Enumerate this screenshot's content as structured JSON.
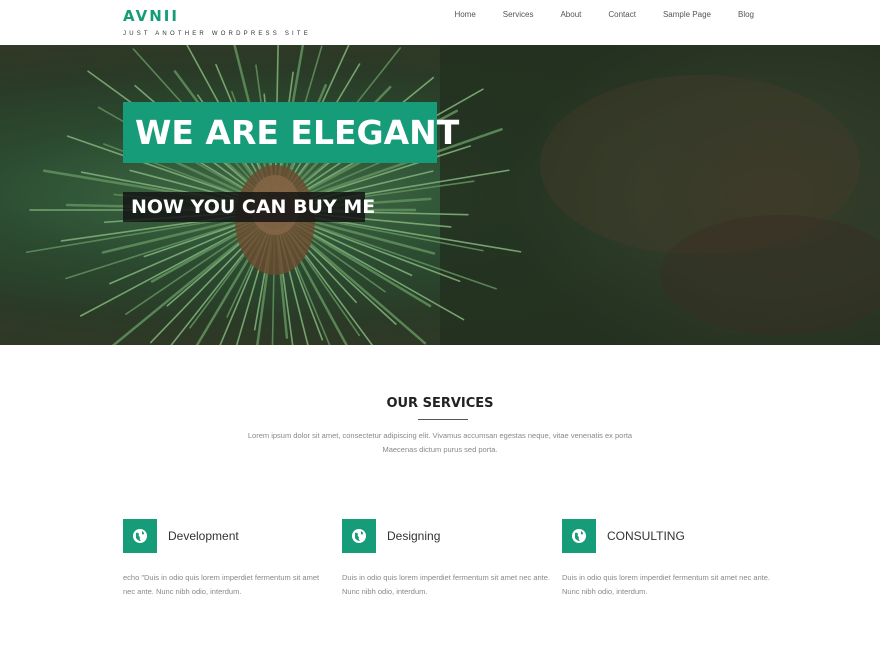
{
  "site": {
    "title": "AVNII",
    "tagline": "JUST ANOTHER WORDPRESS SITE",
    "accent": "#169c78"
  },
  "nav": {
    "items": [
      {
        "label": "Home"
      },
      {
        "label": "Services"
      },
      {
        "label": "About"
      },
      {
        "label": "Contact"
      },
      {
        "label": "Sample Page"
      },
      {
        "label": "Blog"
      }
    ]
  },
  "hero": {
    "title": "WE ARE ELEGANT",
    "subtitle": "NOW YOU CAN BUY ME"
  },
  "services": {
    "heading": "OUR SERVICES",
    "intro_line1": "Lorem ipsum dolor sit amet, consectetur adipiscing elit. Vivamus accumsan egestas neque, vitae venenatis ex porta",
    "intro_line2": "Maecenas dictum purus sed porta.",
    "items": [
      {
        "title": "Development",
        "icon": "globe-icon",
        "text": "echo \"Duis in odio quis lorem imperdiet fermentum sit amet nec ante. Nunc nibh odio, interdum."
      },
      {
        "title": "Designing",
        "icon": "globe-icon",
        "text": "Duis in odio quis lorem imperdiet fermentum sit amet nec ante. Nunc nibh odio, interdum."
      },
      {
        "title": "CONSULTING",
        "icon": "globe-icon",
        "text": "Duis in odio quis lorem imperdiet fermentum sit amet nec ante. Nunc nibh odio, interdum."
      }
    ]
  }
}
